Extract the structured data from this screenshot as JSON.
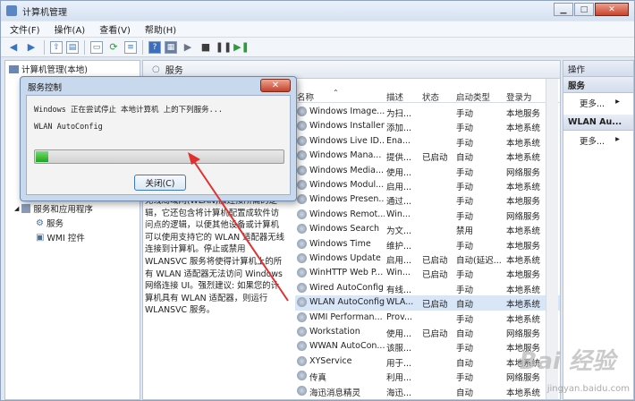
{
  "window": {
    "title": "计算机管理"
  },
  "menu": [
    "文件(F)",
    "操作(A)",
    "查看(V)",
    "帮助(H)"
  ],
  "tree": {
    "root": "计算机管理(本地)",
    "items": [
      "服务和应用程序",
      "服务",
      "WMI 控件"
    ]
  },
  "center": {
    "header": "服务",
    "description": "无线局域网(WLAN)服连接所需的逻辑，它还包含将计算机配置成软件访问点的逻辑，以便其他设备或计算机可以使用支持它的 WLAN 适配器无线连接到计算机。停止或禁用 WLANSVC 服务将使得计算机上的所有 WLAN 适配器无法访问 Windows 网络连接 UI。强烈建议: 如果您的计算机具有 WLAN 适配器，则运行 WLANSVC 服务。",
    "columns": [
      "名称",
      "描述",
      "状态",
      "启动类型",
      "登录为"
    ],
    "rows": [
      {
        "name": "Windows Image...",
        "desc": "为扫...",
        "status": "",
        "startup": "手动",
        "logon": "本地服务"
      },
      {
        "name": "Windows Installer",
        "desc": "添加...",
        "status": "",
        "startup": "手动",
        "logon": "本地系统"
      },
      {
        "name": "Windows Live ID...",
        "desc": "Ena...",
        "status": "",
        "startup": "手动",
        "logon": "本地系统"
      },
      {
        "name": "Windows Mana...",
        "desc": "提供...",
        "status": "已启动",
        "startup": "自动",
        "logon": "本地系统"
      },
      {
        "name": "Windows Media...",
        "desc": "使用...",
        "status": "",
        "startup": "手动",
        "logon": "网络服务"
      },
      {
        "name": "Windows Modul...",
        "desc": "启用...",
        "status": "",
        "startup": "手动",
        "logon": "本地系统"
      },
      {
        "name": "Windows Presen...",
        "desc": "通过...",
        "status": "",
        "startup": "手动",
        "logon": "本地服务"
      },
      {
        "name": "Windows Remot...",
        "desc": "Win...",
        "status": "",
        "startup": "手动",
        "logon": "网络服务"
      },
      {
        "name": "Windows Search",
        "desc": "为文...",
        "status": "",
        "startup": "禁用",
        "logon": "本地系统"
      },
      {
        "name": "Windows Time",
        "desc": "维护...",
        "status": "",
        "startup": "手动",
        "logon": "本地服务"
      },
      {
        "name": "Windows Update",
        "desc": "启用...",
        "status": "已启动",
        "startup": "自动(延迟...",
        "logon": "本地系统"
      },
      {
        "name": "WinHTTP Web P...",
        "desc": "Win...",
        "status": "已启动",
        "startup": "手动",
        "logon": "本地服务"
      },
      {
        "name": "Wired AutoConfig",
        "desc": "有线...",
        "status": "",
        "startup": "手动",
        "logon": "本地系统"
      },
      {
        "name": "WLAN AutoConfig",
        "desc": "WLA...",
        "status": "已启动",
        "startup": "自动",
        "logon": "本地系统"
      },
      {
        "name": "WMI Performan...",
        "desc": "Prov...",
        "status": "",
        "startup": "手动",
        "logon": "本地系统"
      },
      {
        "name": "Workstation",
        "desc": "使用...",
        "status": "已启动",
        "startup": "自动",
        "logon": "网络服务"
      },
      {
        "name": "WWAN AutoCon...",
        "desc": "该服...",
        "status": "",
        "startup": "手动",
        "logon": "本地服务"
      },
      {
        "name": "XYService",
        "desc": "用于...",
        "status": "",
        "startup": "自动",
        "logon": "本地系统"
      },
      {
        "name": "传真",
        "desc": "利用...",
        "status": "",
        "startup": "手动",
        "logon": "网络服务"
      },
      {
        "name": "海迅消息精灵",
        "desc": "海迅...",
        "status": "",
        "startup": "自动",
        "logon": "本地系统"
      }
    ]
  },
  "actions": {
    "title": "操作",
    "section1": "服务",
    "more1": "更多...",
    "section2": "WLAN Au...",
    "more2": "更多..."
  },
  "dialog": {
    "title": "服务控制",
    "message": "Windows 正在尝试停止 本地计算机 上的下列服务...",
    "service": "WLAN AutoConfig",
    "progress": 0.05,
    "close_label": "关闭(C)"
  },
  "watermark": "Bai 经验",
  "watermark_sub": "jingyan.baidu.com",
  "colors": {
    "selected_row": "#d9e6f7",
    "progress": "#1fa31f",
    "arrow": "#e03030"
  }
}
